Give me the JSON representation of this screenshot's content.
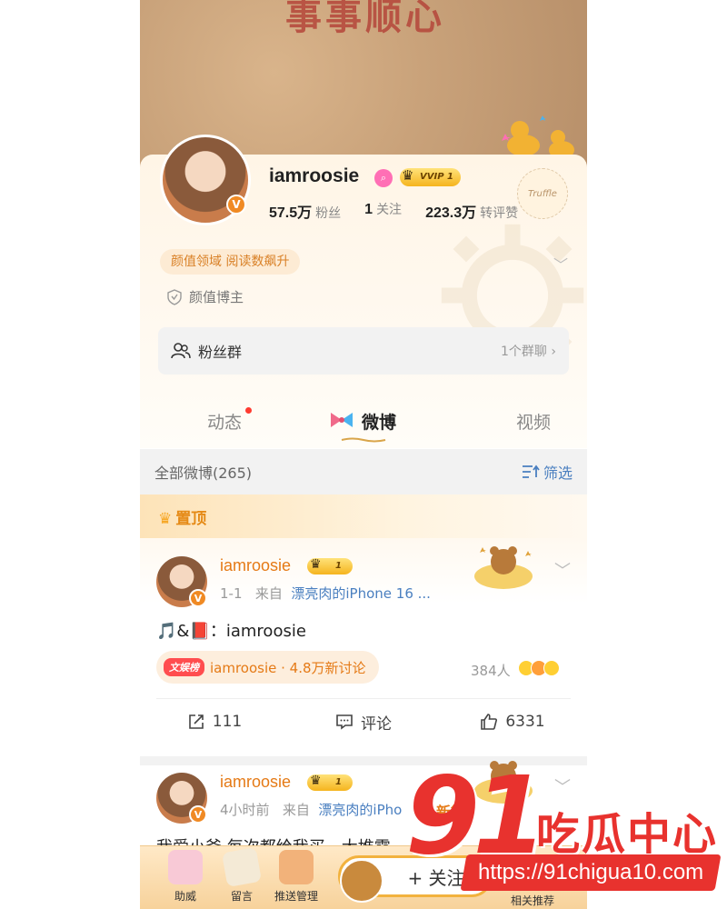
{
  "cover": {
    "text": "事事顺心"
  },
  "profile": {
    "name": "iamroosie",
    "vvip_label": "VVIP 1",
    "stats": [
      {
        "value": "57.5万",
        "label": "粉丝"
      },
      {
        "value": "1",
        "label": "关注"
      },
      {
        "value": "223.3万",
        "label": "转评赞"
      }
    ],
    "truffle_label": "Truffle",
    "tag": "颜值领域 阅读数飙升",
    "role": "颜值博主",
    "fans_group": {
      "label": "粉丝群",
      "right": "1个群聊"
    }
  },
  "tabs": [
    {
      "label": "动态",
      "has_dot": true
    },
    {
      "label": "微博",
      "active": true
    },
    {
      "label": "视频"
    }
  ],
  "list": {
    "total": "全部微博(265)",
    "filter": "筛选",
    "pinned": "置顶"
  },
  "posts": [
    {
      "name": "iamroosie",
      "level": "1",
      "time": "1-1",
      "from": "来自",
      "source": "漂亮肉的iPhone 16 ...",
      "body": "🎵&📕：iamroosie",
      "topic_badge": "文娱榜",
      "topic_text": "iamroosie · 4.8万新讨论",
      "react_count": "384人",
      "actions": {
        "repost": "111",
        "comment": "评论",
        "like": "6331"
      }
    },
    {
      "name": "iamroosie",
      "level": "1",
      "time": "4小时前",
      "from": "来自",
      "source": "漂亮肉的iPho",
      "body": "我爱小爸 每次都给我买一大堆零"
    }
  ],
  "bottom_bar": {
    "items": [
      "助威",
      "留言",
      "推送管理"
    ],
    "follow": "+ 关注",
    "related": "相关推荐",
    "new_badge": "新微"
  },
  "watermark": {
    "big": "91",
    "cn": "吃瓜中心",
    "url": "https://91chigua10.com"
  },
  "colors": {
    "accent": "#e57a16",
    "link": "#4a7fc0",
    "watermark_red": "#e8322e"
  }
}
